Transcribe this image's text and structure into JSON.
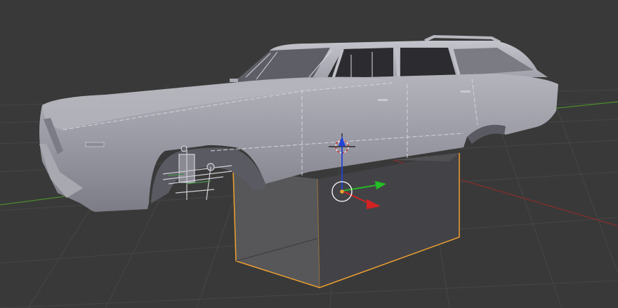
{
  "app": {
    "name": "",
    "view": ""
  },
  "viewport": {
    "background_color": "#393939",
    "grid_color": "#464646",
    "x_axis_color": "#8a2c2c",
    "y_axis_color": "#4c8a2c",
    "selection_outline_color": "#f0a030"
  },
  "scene": {
    "objects": [
      {
        "name": "station-wagon-body",
        "material_color": "#9a9aa4",
        "selected": false
      },
      {
        "name": "cube",
        "material_color": "#4a4a4f",
        "selected": true
      }
    ],
    "cursor_3d": {
      "icon": "crosshair-ring-icon"
    },
    "transform_manipulator": {
      "axes": [
        {
          "axis": "x",
          "color": "#d42222"
        },
        {
          "axis": "y",
          "color": "#22c022"
        },
        {
          "axis": "z",
          "color": "#2244d8"
        }
      ]
    }
  }
}
